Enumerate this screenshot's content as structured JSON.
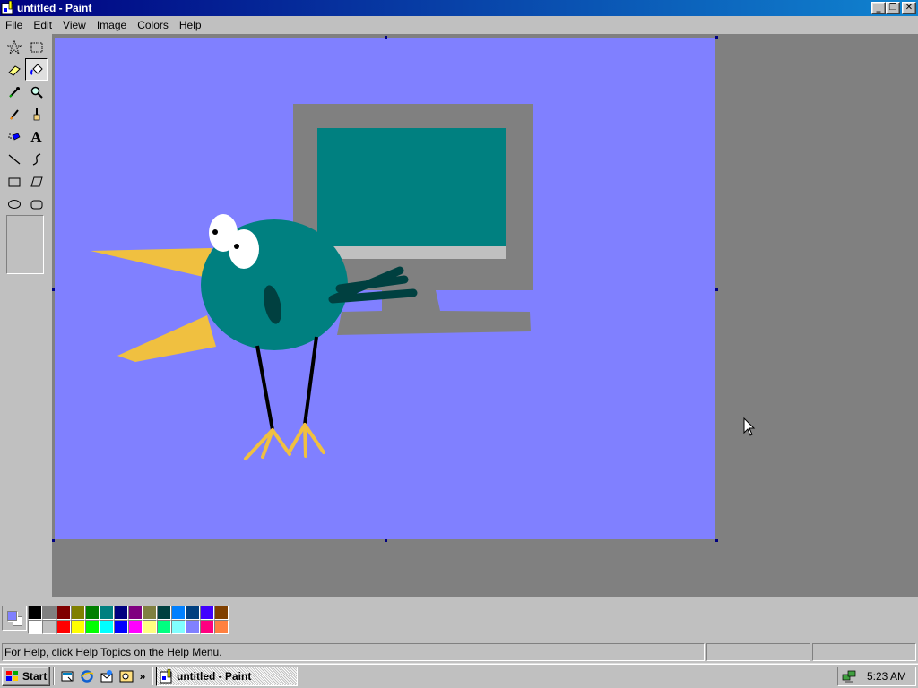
{
  "window": {
    "title": "untitled - Paint",
    "controls": {
      "minimize": "_",
      "maximize": "❐",
      "close": "✕"
    }
  },
  "menu": [
    "File",
    "Edit",
    "View",
    "Image",
    "Colors",
    "Help"
  ],
  "tools": [
    {
      "name": "free-form-select",
      "icon": "star-select-icon"
    },
    {
      "name": "select",
      "icon": "rect-select-icon"
    },
    {
      "name": "eraser",
      "icon": "eraser-icon"
    },
    {
      "name": "fill-with-color",
      "icon": "paint-bucket-icon",
      "active": true
    },
    {
      "name": "pick-color",
      "icon": "eyedropper-icon"
    },
    {
      "name": "magnifier",
      "icon": "magnifier-icon"
    },
    {
      "name": "pencil",
      "icon": "pencil-icon"
    },
    {
      "name": "brush",
      "icon": "brush-icon"
    },
    {
      "name": "airbrush",
      "icon": "airbrush-icon"
    },
    {
      "name": "text",
      "icon": "text-icon",
      "label": "A"
    },
    {
      "name": "line",
      "icon": "line-icon"
    },
    {
      "name": "curve",
      "icon": "curve-icon"
    },
    {
      "name": "rectangle",
      "icon": "rectangle-icon"
    },
    {
      "name": "polygon",
      "icon": "polygon-icon"
    },
    {
      "name": "ellipse",
      "icon": "ellipse-icon"
    },
    {
      "name": "rounded-rectangle",
      "icon": "rounded-rectangle-icon"
    }
  ],
  "colors": {
    "foreground": "#8080ff",
    "background": "#ffffff",
    "palette_top": [
      "#000000",
      "#808080",
      "#800000",
      "#808000",
      "#008000",
      "#008080",
      "#000080",
      "#800080",
      "#808040",
      "#004040",
      "#0080ff",
      "#004080",
      "#4000ff",
      "#804000"
    ],
    "palette_bottom": [
      "#ffffff",
      "#c0c0c0",
      "#ff0000",
      "#ffff00",
      "#00ff00",
      "#00ffff",
      "#0000ff",
      "#ff00ff",
      "#ffff80",
      "#00ff80",
      "#80ffff",
      "#8080ff",
      "#ff0080",
      "#ff8040"
    ]
  },
  "status": {
    "help_text": "For Help, click Help Topics on the Help Menu.",
    "coords": "",
    "size": ""
  },
  "taskbar": {
    "start_label": "Start",
    "quicklaunch_more": "»",
    "task_label": "untitled - Paint",
    "clock": "5:23 AM"
  }
}
